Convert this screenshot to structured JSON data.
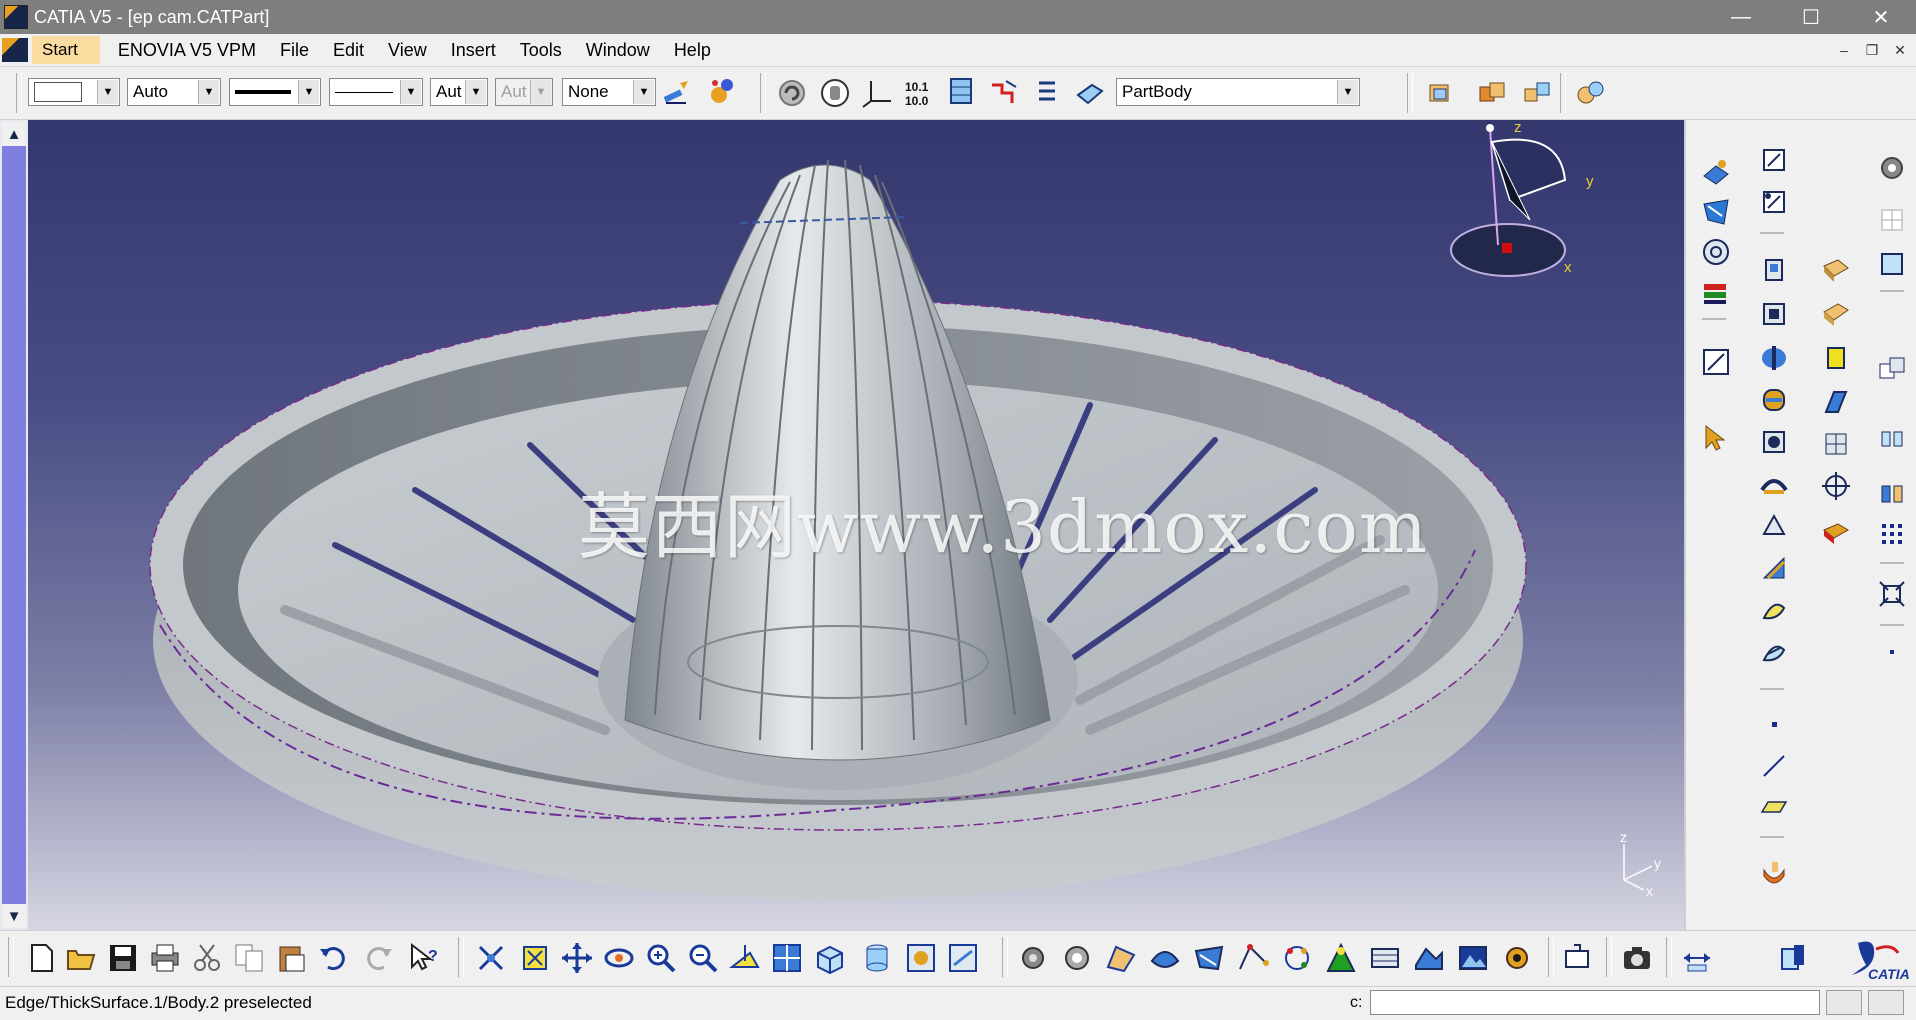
{
  "window": {
    "title": "CATIA V5 - [ep cam.CATPart]",
    "minimize": "—",
    "maximize": "☐",
    "close": "✕"
  },
  "menu": {
    "start": "Start",
    "items": [
      "ENOVIA V5 VPM",
      "File",
      "Edit",
      "View",
      "Insert",
      "Tools",
      "Window",
      "Help"
    ],
    "mdi_buttons": [
      "–",
      "❐",
      "✕"
    ]
  },
  "toolbar": {
    "color_value": "",
    "transparency_value": "Auto",
    "line_weight_value": "",
    "line_type_value": "",
    "layer_value": "Aut",
    "layer2_value": "Aut",
    "render_style_value": "None",
    "part_body_value": "PartBody"
  },
  "viewport": {
    "watermark": "莫西网www.3dmox.com",
    "compass": {
      "z": "z",
      "y": "y",
      "x": "x"
    },
    "axis_triad": {
      "z": "z",
      "y": "y",
      "x": "x"
    }
  },
  "status": {
    "message": "Edge/ThickSurface.1/Body.2 preselected",
    "command_label": "c:",
    "command_value": ""
  },
  "icons": {
    "top": [
      "format-painter-icon",
      "apply-material-icon",
      "update-icon",
      "hand-icon",
      "axis-system-icon",
      "measure-icon",
      "scan-icon",
      "snap-icon",
      "parameters-icon",
      "body-icon",
      "part-body-icon",
      "insert-body-icon",
      "assemble-icon",
      "boolean-icon"
    ],
    "bottom": [
      "new-icon",
      "open-icon",
      "save-icon",
      "print-icon",
      "cut-icon",
      "copy-icon",
      "paste-icon",
      "undo-icon",
      "redo-icon",
      "whats-this-icon",
      "fly-mode-icon",
      "fit-all-icon",
      "pan-icon",
      "rotate-icon",
      "zoom-in-icon",
      "zoom-out-icon",
      "normal-view-icon",
      "multi-view-icon",
      "iso-view-icon",
      "shading-icon",
      "hide-show-icon",
      "swap-space-icon",
      "catalog-icon",
      "settings-icon",
      "shape-design-icon",
      "kinematics-icon",
      "analysis-icon",
      "tolerancing-icon",
      "simulation-icon",
      "knowledge-icon",
      "wireframe-icon",
      "photo-studio-icon",
      "image-icon",
      "capture-icon",
      "snapshot-icon",
      "measure-between-icon",
      "measure-item-icon",
      "catia-logo"
    ],
    "right_col1": [
      "sketch-based-icon",
      "dress-up-icon",
      "transformation-icon",
      "boolean-icon",
      "sketcher-icon",
      "select-icon"
    ],
    "right_col2": [
      "sketch-icon",
      "positioned-sketch-icon",
      "pad-icon",
      "pocket-icon",
      "shaft-icon",
      "groove-icon",
      "hole-icon",
      "rib-icon",
      "slot-icon",
      "stiffener-icon",
      "multi-section-icon",
      "removed-section-icon",
      "point-icon",
      "line-icon",
      "plane-icon",
      "thick-surface-icon"
    ],
    "right_col3": [
      "fillet-icon",
      "chamfer-icon",
      "draft-icon",
      "shell-icon",
      "thickness-icon",
      "thread-icon",
      "remove-face-icon",
      "replace-face-icon"
    ],
    "right_col4": [
      "settings-icon",
      "grid-icon",
      "constraint-icon",
      "axis-icon",
      "mirror-icon",
      "pattern-icon",
      "scale-icon",
      "point-small-icon"
    ]
  },
  "colors": {
    "viewport_top": "#34376e",
    "viewport_bottom": "#d6d6e2",
    "accent_start": "#fadca0",
    "model_gray": "#b8bec4"
  }
}
